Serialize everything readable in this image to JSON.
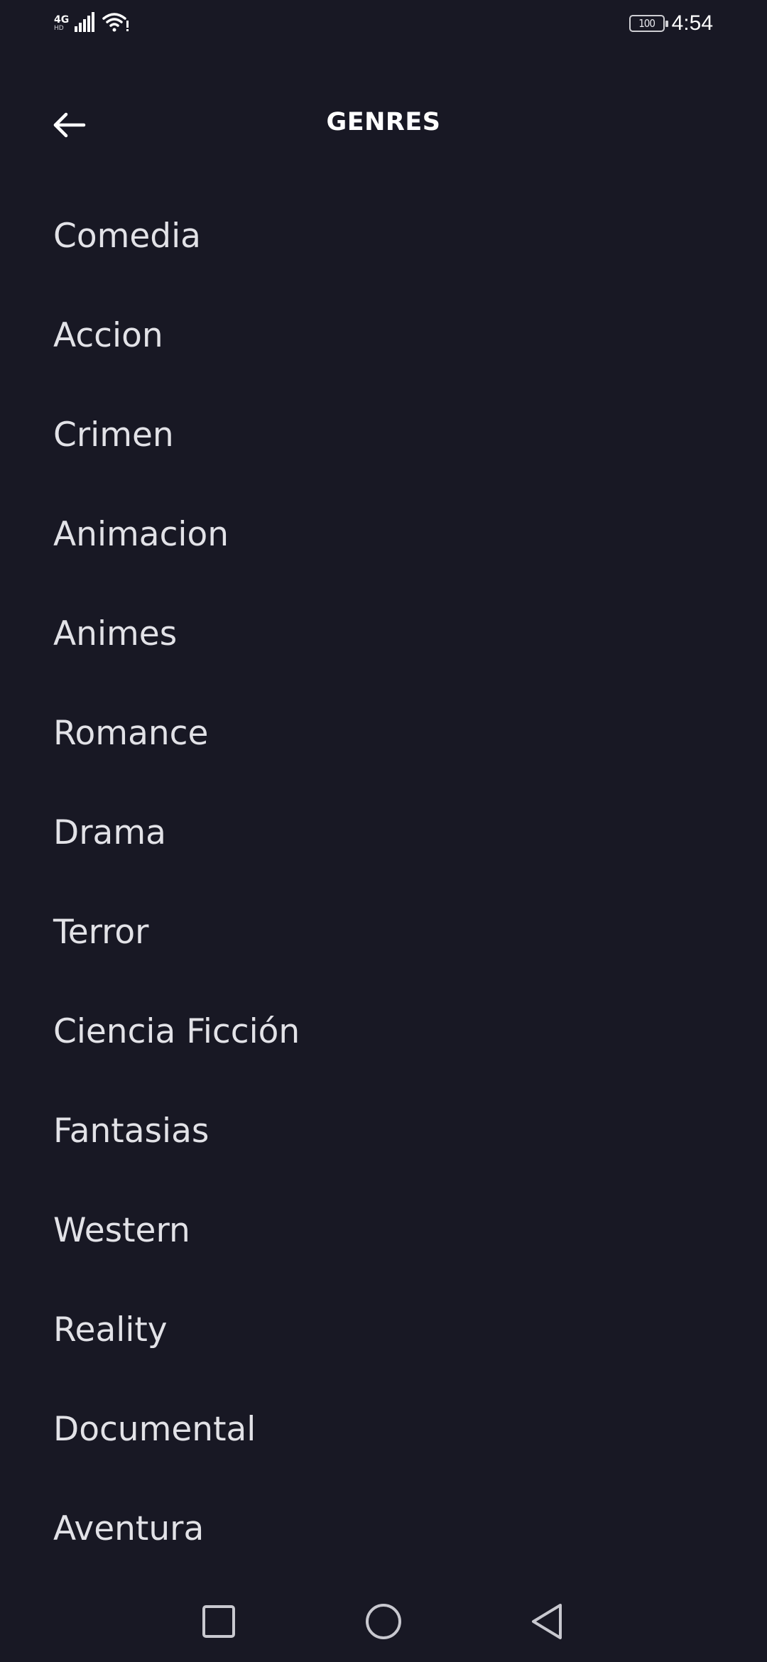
{
  "status_bar": {
    "network": "4G",
    "network_sub": "HD",
    "battery": "100",
    "time": "4:54"
  },
  "header": {
    "title": "GENRES",
    "back_icon": "arrow-left-icon"
  },
  "genres": [
    {
      "label": "Comedia"
    },
    {
      "label": "Accion"
    },
    {
      "label": "Crimen"
    },
    {
      "label": "Animacion"
    },
    {
      "label": "Animes"
    },
    {
      "label": "Romance"
    },
    {
      "label": "Drama"
    },
    {
      "label": "Terror"
    },
    {
      "label": "Ciencia Ficción"
    },
    {
      "label": "Fantasias"
    },
    {
      "label": "Western"
    },
    {
      "label": "Reality"
    },
    {
      "label": "Documental"
    },
    {
      "label": "Aventura"
    }
  ],
  "nav": {
    "recent_icon": "square-icon",
    "home_icon": "circle-icon",
    "back_icon": "triangle-back-icon"
  },
  "colors": {
    "background": "#181824",
    "text": "#e2e2e7",
    "title": "#ffffff"
  }
}
